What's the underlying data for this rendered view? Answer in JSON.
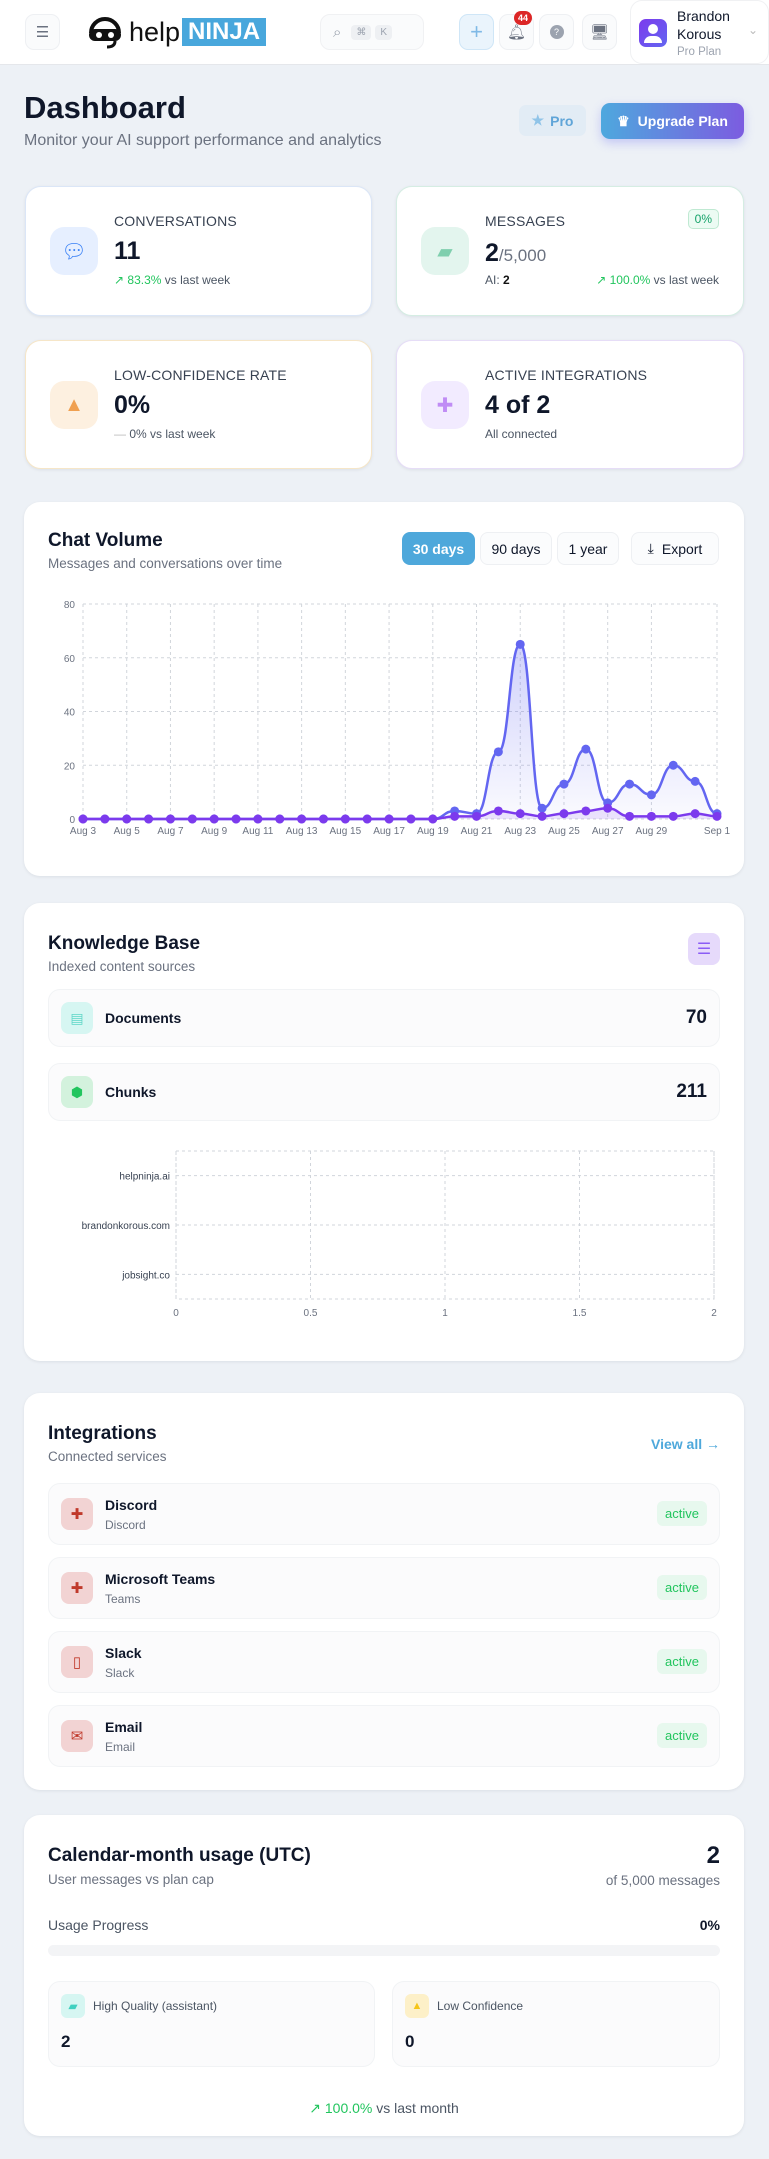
{
  "header": {
    "logo_text": "help",
    "logo_brand": "NINJA",
    "search_kbd_1": "⌘",
    "search_kbd_2": "K",
    "notification_count": "44",
    "user_first": "Brandon",
    "user_last": "Korous",
    "user_plan": "Pro Plan"
  },
  "page": {
    "title": "Dashboard",
    "subtitle": "Monitor your AI support performance and analytics",
    "pro_label": "Pro",
    "upgrade_label": "Upgrade Plan"
  },
  "stats": {
    "conversations": {
      "label": "CONVERSATIONS",
      "value": "11",
      "change": "83.3%",
      "change_suffix": "vs last week"
    },
    "messages": {
      "label": "MESSAGES",
      "value": "2",
      "cap": "/5,000",
      "badge": "0%",
      "ai_label": "AI:",
      "ai_value": "2",
      "change": "100.0%",
      "change_suffix": "vs last week"
    },
    "low_confidence": {
      "label": "LOW-CONFIDENCE RATE",
      "value": "0%",
      "change": "0%",
      "change_suffix": "vs last week"
    },
    "integrations": {
      "label": "ACTIVE INTEGRATIONS",
      "value": "4 of 2",
      "note": "All connected"
    }
  },
  "chat_volume": {
    "title": "Chat Volume",
    "subtitle": "Messages and conversations over time",
    "ranges": [
      "30 days",
      "90 days",
      "1 year"
    ],
    "export_label": "Export"
  },
  "knowledge_base": {
    "title": "Knowledge Base",
    "subtitle": "Indexed content sources",
    "documents_label": "Documents",
    "documents_value": "70",
    "chunks_label": "Chunks",
    "chunks_value": "211"
  },
  "integrations": {
    "title": "Integrations",
    "subtitle": "Connected services",
    "view_all": "View all",
    "items": [
      {
        "name": "Discord",
        "type": "Discord",
        "status": "active"
      },
      {
        "name": "Microsoft Teams",
        "type": "Teams",
        "status": "active"
      },
      {
        "name": "Slack",
        "type": "Slack",
        "status": "active"
      },
      {
        "name": "Email",
        "type": "Email",
        "status": "active"
      }
    ]
  },
  "usage": {
    "title": "Calendar-month usage (UTC)",
    "subtitle": "User messages vs plan cap",
    "value": "2",
    "of_label": "of 5,000 messages",
    "progress_label": "Usage Progress",
    "progress_text": "0%",
    "progress": 0,
    "high_quality_label": "High Quality (assistant)",
    "high_quality_value": "2",
    "low_conf_label": "Low Confidence",
    "low_conf_value": "0",
    "change": "100.0%",
    "change_suffix": "vs last month"
  },
  "chart_data": [
    {
      "type": "line",
      "title": "Chat Volume",
      "x": [
        "Aug 3",
        "Aug 4",
        "Aug 5",
        "Aug 6",
        "Aug 7",
        "Aug 8",
        "Aug 9",
        "Aug 10",
        "Aug 11",
        "Aug 12",
        "Aug 13",
        "Aug 14",
        "Aug 15",
        "Aug 16",
        "Aug 17",
        "Aug 18",
        "Aug 19",
        "Aug 20",
        "Aug 21",
        "Aug 22",
        "Aug 23",
        "Aug 24",
        "Aug 25",
        "Aug 26",
        "Aug 27",
        "Aug 28",
        "Aug 29",
        "Aug 30",
        "Aug 31",
        "Sep 1"
      ],
      "xticks": [
        "Aug 3",
        "Aug 5",
        "Aug 7",
        "Aug 9",
        "Aug 11",
        "Aug 13",
        "Aug 15",
        "Aug 17",
        "Aug 19",
        "Aug 21",
        "Aug 23",
        "Aug 25",
        "Aug 27",
        "Aug 29",
        "Sep 1"
      ],
      "yticks": [
        "0",
        "20",
        "40",
        "60",
        "80"
      ],
      "ylim": [
        0,
        80
      ],
      "grid": true,
      "series": [
        {
          "name": "Messages",
          "color": "#6366f1",
          "values": [
            0,
            0,
            0,
            0,
            0,
            0,
            0,
            0,
            0,
            0,
            0,
            0,
            0,
            0,
            0,
            0,
            0,
            3,
            2,
            25,
            65,
            4,
            13,
            26,
            6,
            13,
            9,
            20,
            14,
            2
          ]
        },
        {
          "name": "Conversations",
          "color": "#7c3aed",
          "values": [
            0,
            0,
            0,
            0,
            0,
            0,
            0,
            0,
            0,
            0,
            0,
            0,
            0,
            0,
            0,
            0,
            0,
            1,
            1,
            3,
            2,
            1,
            2,
            3,
            4,
            1,
            1,
            1,
            2,
            1
          ]
        }
      ]
    },
    {
      "type": "bar",
      "orientation": "horizontal",
      "categories": [
        "helpninja.ai",
        "brandonkorous.com",
        "jobsight.co"
      ],
      "values": [
        0,
        0,
        0
      ],
      "xlim": [
        0,
        2
      ],
      "xticks": [
        "0",
        "0.5",
        "1",
        "1.5",
        "2"
      ],
      "grid": true
    }
  ]
}
